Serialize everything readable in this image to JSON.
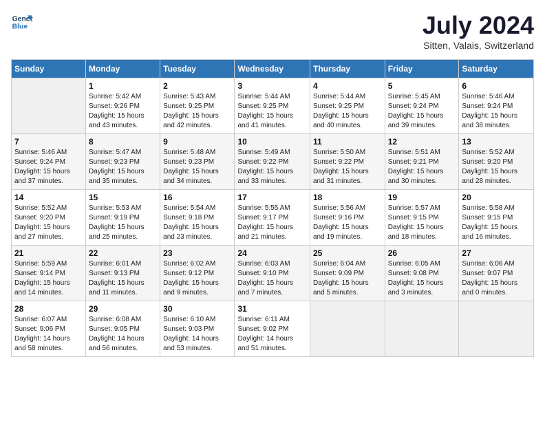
{
  "header": {
    "logo_line1": "General",
    "logo_line2": "Blue",
    "month_year": "July 2024",
    "location": "Sitten, Valais, Switzerland"
  },
  "days_of_week": [
    "Sunday",
    "Monday",
    "Tuesday",
    "Wednesday",
    "Thursday",
    "Friday",
    "Saturday"
  ],
  "weeks": [
    [
      {
        "day": "",
        "info": ""
      },
      {
        "day": "1",
        "info": "Sunrise: 5:42 AM\nSunset: 9:26 PM\nDaylight: 15 hours\nand 43 minutes."
      },
      {
        "day": "2",
        "info": "Sunrise: 5:43 AM\nSunset: 9:25 PM\nDaylight: 15 hours\nand 42 minutes."
      },
      {
        "day": "3",
        "info": "Sunrise: 5:44 AM\nSunset: 9:25 PM\nDaylight: 15 hours\nand 41 minutes."
      },
      {
        "day": "4",
        "info": "Sunrise: 5:44 AM\nSunset: 9:25 PM\nDaylight: 15 hours\nand 40 minutes."
      },
      {
        "day": "5",
        "info": "Sunrise: 5:45 AM\nSunset: 9:24 PM\nDaylight: 15 hours\nand 39 minutes."
      },
      {
        "day": "6",
        "info": "Sunrise: 5:46 AM\nSunset: 9:24 PM\nDaylight: 15 hours\nand 38 minutes."
      }
    ],
    [
      {
        "day": "7",
        "info": "Sunrise: 5:46 AM\nSunset: 9:24 PM\nDaylight: 15 hours\nand 37 minutes."
      },
      {
        "day": "8",
        "info": "Sunrise: 5:47 AM\nSunset: 9:23 PM\nDaylight: 15 hours\nand 35 minutes."
      },
      {
        "day": "9",
        "info": "Sunrise: 5:48 AM\nSunset: 9:23 PM\nDaylight: 15 hours\nand 34 minutes."
      },
      {
        "day": "10",
        "info": "Sunrise: 5:49 AM\nSunset: 9:22 PM\nDaylight: 15 hours\nand 33 minutes."
      },
      {
        "day": "11",
        "info": "Sunrise: 5:50 AM\nSunset: 9:22 PM\nDaylight: 15 hours\nand 31 minutes."
      },
      {
        "day": "12",
        "info": "Sunrise: 5:51 AM\nSunset: 9:21 PM\nDaylight: 15 hours\nand 30 minutes."
      },
      {
        "day": "13",
        "info": "Sunrise: 5:52 AM\nSunset: 9:20 PM\nDaylight: 15 hours\nand 28 minutes."
      }
    ],
    [
      {
        "day": "14",
        "info": "Sunrise: 5:52 AM\nSunset: 9:20 PM\nDaylight: 15 hours\nand 27 minutes."
      },
      {
        "day": "15",
        "info": "Sunrise: 5:53 AM\nSunset: 9:19 PM\nDaylight: 15 hours\nand 25 minutes."
      },
      {
        "day": "16",
        "info": "Sunrise: 5:54 AM\nSunset: 9:18 PM\nDaylight: 15 hours\nand 23 minutes."
      },
      {
        "day": "17",
        "info": "Sunrise: 5:55 AM\nSunset: 9:17 PM\nDaylight: 15 hours\nand 21 minutes."
      },
      {
        "day": "18",
        "info": "Sunrise: 5:56 AM\nSunset: 9:16 PM\nDaylight: 15 hours\nand 19 minutes."
      },
      {
        "day": "19",
        "info": "Sunrise: 5:57 AM\nSunset: 9:15 PM\nDaylight: 15 hours\nand 18 minutes."
      },
      {
        "day": "20",
        "info": "Sunrise: 5:58 AM\nSunset: 9:15 PM\nDaylight: 15 hours\nand 16 minutes."
      }
    ],
    [
      {
        "day": "21",
        "info": "Sunrise: 5:59 AM\nSunset: 9:14 PM\nDaylight: 15 hours\nand 14 minutes."
      },
      {
        "day": "22",
        "info": "Sunrise: 6:01 AM\nSunset: 9:13 PM\nDaylight: 15 hours\nand 11 minutes."
      },
      {
        "day": "23",
        "info": "Sunrise: 6:02 AM\nSunset: 9:12 PM\nDaylight: 15 hours\nand 9 minutes."
      },
      {
        "day": "24",
        "info": "Sunrise: 6:03 AM\nSunset: 9:10 PM\nDaylight: 15 hours\nand 7 minutes."
      },
      {
        "day": "25",
        "info": "Sunrise: 6:04 AM\nSunset: 9:09 PM\nDaylight: 15 hours\nand 5 minutes."
      },
      {
        "day": "26",
        "info": "Sunrise: 6:05 AM\nSunset: 9:08 PM\nDaylight: 15 hours\nand 3 minutes."
      },
      {
        "day": "27",
        "info": "Sunrise: 6:06 AM\nSunset: 9:07 PM\nDaylight: 15 hours\nand 0 minutes."
      }
    ],
    [
      {
        "day": "28",
        "info": "Sunrise: 6:07 AM\nSunset: 9:06 PM\nDaylight: 14 hours\nand 58 minutes."
      },
      {
        "day": "29",
        "info": "Sunrise: 6:08 AM\nSunset: 9:05 PM\nDaylight: 14 hours\nand 56 minutes."
      },
      {
        "day": "30",
        "info": "Sunrise: 6:10 AM\nSunset: 9:03 PM\nDaylight: 14 hours\nand 53 minutes."
      },
      {
        "day": "31",
        "info": "Sunrise: 6:11 AM\nSunset: 9:02 PM\nDaylight: 14 hours\nand 51 minutes."
      },
      {
        "day": "",
        "info": ""
      },
      {
        "day": "",
        "info": ""
      },
      {
        "day": "",
        "info": ""
      }
    ]
  ]
}
